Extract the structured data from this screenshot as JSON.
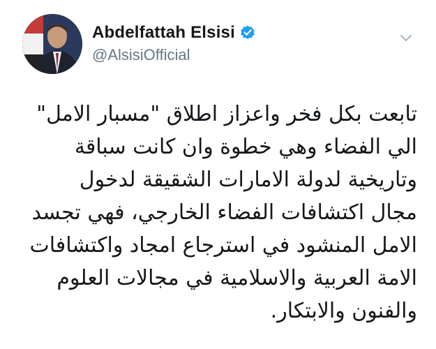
{
  "tweet": {
    "author": {
      "display_name": "Abdelfattah Elsisi",
      "handle": "@AlsisiOfficial",
      "verified": true,
      "avatar_icon": "profile-photo-icon"
    },
    "menu_icon": "chevron-down-icon",
    "text_lines": [
      "تابعت بكل فخر واعزاز اطلاق \"مسبار الامل\"",
      "الي الفضاء وهي خطوة وان كانت سباقة",
      "وتاريخية لدولة الامارات الشقيقة لدخول",
      "مجال اكتشافات الفضاء الخارجي، فهي تجسد",
      "الامل المنشود في استرجاع امجاد واكتشافات",
      "الامة العربية والاسلامية في مجالات العلوم",
      "والفنون والابتكار."
    ]
  },
  "colors": {
    "text_primary": "#14171a",
    "text_secondary": "#657786",
    "verified_blue": "#1da1f2",
    "caret_gray": "#aab8c2"
  }
}
